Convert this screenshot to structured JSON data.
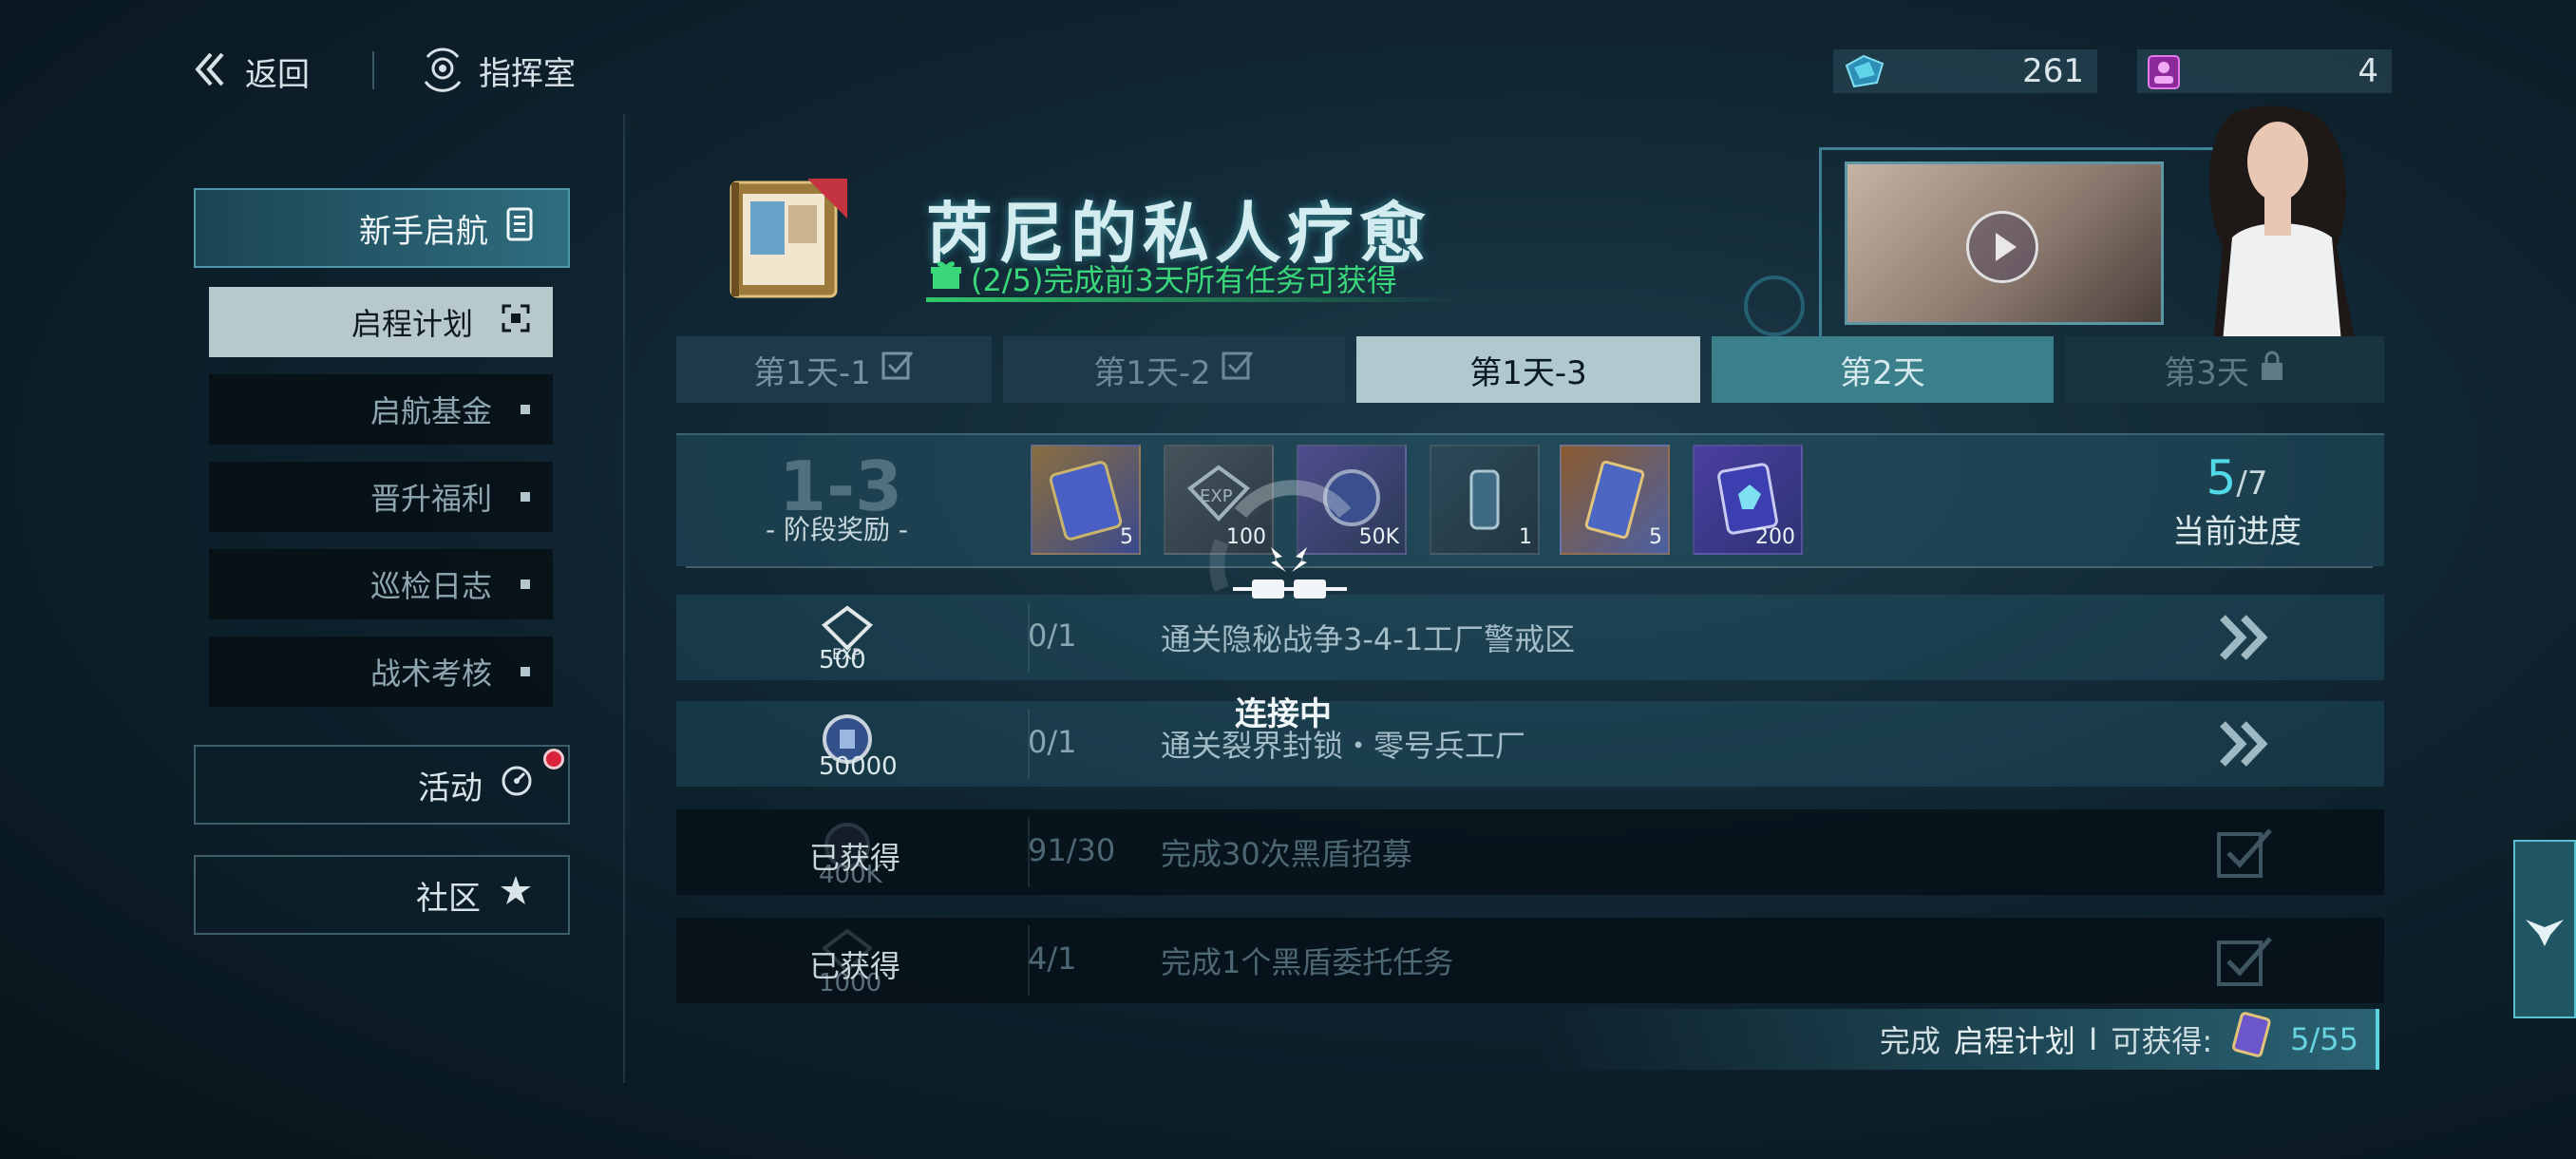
{
  "header": {
    "back_label": "返回",
    "location_label": "指挥室",
    "resources": [
      {
        "icon": "crystal-icon",
        "value": "261",
        "color": "#4fc7e0"
      },
      {
        "icon": "recruit-ticket-icon",
        "value": "4",
        "color": "#d25be0"
      }
    ]
  },
  "sidebar": {
    "main_label": "新手启航",
    "items": [
      {
        "label": "启程计划",
        "active": true
      },
      {
        "label": "启航基金",
        "active": false
      },
      {
        "label": "晋升福利",
        "active": false
      },
      {
        "label": "巡检日志",
        "active": false
      },
      {
        "label": "战术考核",
        "active": false
      }
    ],
    "activity_label": "活动",
    "community_label": "社区"
  },
  "banner": {
    "title": "芮尼的私人疗愈",
    "subtitle": "(2/5)完成前3天所有任务可获得",
    "accent_color": "#3ad67a"
  },
  "tabs": [
    {
      "label": "第1天-1",
      "state": "completed"
    },
    {
      "label": "第1天-2",
      "state": "completed"
    },
    {
      "label": "第1天-3",
      "state": "selected"
    },
    {
      "label": "第2天",
      "state": "available"
    },
    {
      "label": "第3天",
      "state": "locked"
    }
  ],
  "stage": {
    "number": "1-3",
    "label": "- 阶段奖励 -",
    "rewards": [
      {
        "icon": "card-pack-icon",
        "count": "5"
      },
      {
        "icon": "exp-chip-icon",
        "count": "100"
      },
      {
        "icon": "coin-icon",
        "count": "50K"
      },
      {
        "icon": "capsule-icon",
        "count": "1"
      },
      {
        "icon": "ticket-icon",
        "count": "5"
      },
      {
        "icon": "crystal-pack-icon",
        "count": "200"
      }
    ],
    "progress_current": "5",
    "progress_total": "/7",
    "progress_label": "当前进度"
  },
  "tasks": [
    {
      "reward_icon": "exp-chip-icon",
      "reward_count": "500",
      "progress": "0/1",
      "description": "通关隐秘战争3-4-1工厂警戒区",
      "status": "open"
    },
    {
      "reward_icon": "coin-icon",
      "reward_count": "50000",
      "progress": "0/1",
      "description": "通关裂界封锁・零号兵工厂",
      "status": "open"
    },
    {
      "reward_icon": "coin-icon",
      "reward_count": "400K",
      "progress": "91/30",
      "description": "完成30次黑盾招募",
      "status": "claimed",
      "claimed_label": "已获得"
    },
    {
      "reward_icon": "exp-chip-icon",
      "reward_count": "1000",
      "progress": "4/1",
      "description": "完成1个黑盾委托任务",
      "status": "claimed",
      "claimed_label": "已获得"
    }
  ],
  "footer": {
    "prefix": "完成",
    "plan_name": "启程计划",
    "separator": "I",
    "suffix": "可获得:",
    "ratio": "5/55"
  },
  "overlay": {
    "text": "连接中"
  }
}
